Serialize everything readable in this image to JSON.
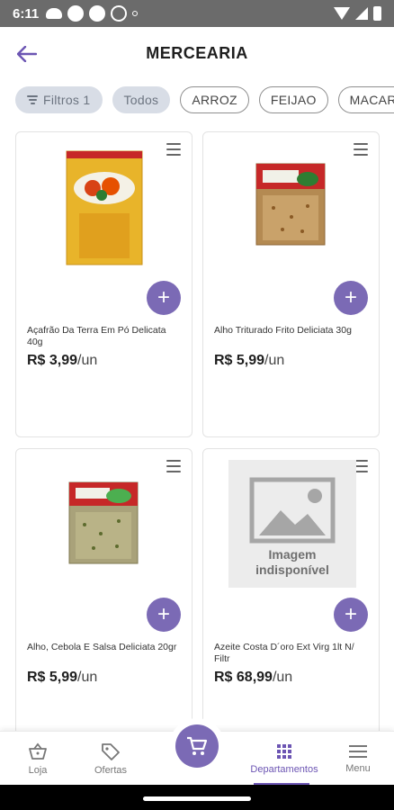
{
  "status_bar": {
    "time": "6:11"
  },
  "header": {
    "title": "MERCEARIA"
  },
  "filters": {
    "filter_button": "Filtros 1",
    "chips": [
      "Todos",
      "ARROZ",
      "FEIJAO",
      "MACARRÃO"
    ]
  },
  "products": [
    {
      "name": "Açafrão Da Terra Em Pó Delicata 40g",
      "price": "R$ 3,99",
      "unit": "/un",
      "image": "acafrao-package"
    },
    {
      "name": "Alho Triturado Frito Deliciata 30g",
      "price": "R$ 5,99",
      "unit": "/un",
      "image": "alho-package"
    },
    {
      "name": "Alho, Cebola E Salsa Deliciata 20gr",
      "price": "R$ 5,99",
      "unit": "/un",
      "image": "alho-cebola-package"
    },
    {
      "name": "Azeite Costa D´oro Ext Virg 1lt N/ Filtr",
      "price": "R$ 68,99",
      "unit": "/un",
      "image": "image-unavailable",
      "placeholder_text_1": "Imagem",
      "placeholder_text_2": "indisponível"
    }
  ],
  "bottom_nav": {
    "items": [
      "Loja",
      "Ofertas",
      "Departamentos",
      "Menu"
    ],
    "active": "Departamentos"
  },
  "colors": {
    "accent": "#7b6ab5",
    "active_nav": "#6c55b3",
    "chip_filled": "#d8dde6"
  }
}
